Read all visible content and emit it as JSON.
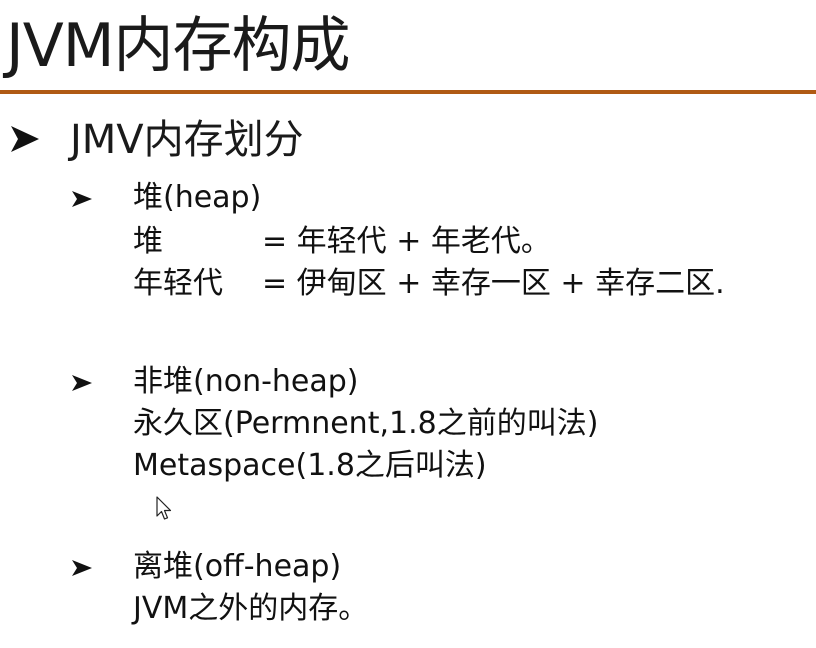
{
  "slide": {
    "title": "JVM内存构成",
    "bullet": "JMV内存划分",
    "sections": [
      {
        "heading": "堆(heap)",
        "lines": [
          {
            "left": "堆",
            "right": "= 年轻代 + 年老代。"
          },
          {
            "left": "年轻代",
            "right": "= 伊甸区 + 幸存一区 + 幸存二区."
          }
        ]
      },
      {
        "heading": "非堆(non-heap)",
        "lines": [
          {
            "text": "永久区(Permnent,1.8之前的叫法)"
          },
          {
            "text": "Metaspace(1.8之后叫法)"
          }
        ]
      },
      {
        "heading": "离堆(off-heap)",
        "lines": [
          {
            "text": "JVM之外的内存。"
          }
        ]
      }
    ]
  },
  "icons": {
    "bullet_marker": "arrow-bullet-icon",
    "cursor": "mouse-cursor-icon"
  },
  "colors": {
    "title_rule": "#b05a14",
    "text": "#111111"
  }
}
